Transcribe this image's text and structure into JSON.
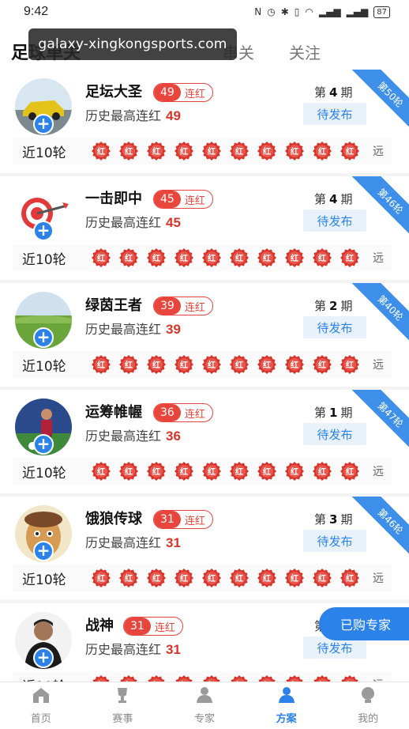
{
  "status": {
    "time": "9:42",
    "battery": "87",
    "icons": [
      "nfc",
      "alarm",
      "bluetooth",
      "vibrate",
      "wifi",
      "signal-1",
      "signal-2",
      "battery"
    ]
  },
  "watermark": "galaxy-xingkongsports.com",
  "top_tabs": [
    {
      "label": "足球单关",
      "active": true
    },
    {
      "label": "串关",
      "active": false
    },
    {
      "label": "关注",
      "active": false
    }
  ],
  "experts": [
    {
      "name": "足坛大圣",
      "streak": "49",
      "streak_label": "连红",
      "history_label": "历史最高连红",
      "history_value": "49",
      "issue_prefix": "第",
      "issue_num": "4",
      "issue_suffix": "期",
      "status": "待发布",
      "ribbon": "第50轮",
      "avatar": "car",
      "recent_label": "近10轮",
      "recent": [
        "红",
        "红",
        "红",
        "红",
        "红",
        "红",
        "红",
        "红",
        "红",
        "红"
      ],
      "more": "远"
    },
    {
      "name": "一击即中",
      "streak": "45",
      "streak_label": "连红",
      "history_label": "历史最高连红",
      "history_value": "45",
      "issue_prefix": "第",
      "issue_num": "4",
      "issue_suffix": "期",
      "status": "待发布",
      "ribbon": "第46轮",
      "avatar": "target",
      "recent_label": "近10轮",
      "recent": [
        "红",
        "红",
        "红",
        "红",
        "红",
        "红",
        "红",
        "红",
        "红",
        "红"
      ],
      "more": "远"
    },
    {
      "name": "绿茵王者",
      "streak": "39",
      "streak_label": "连红",
      "history_label": "历史最高连红",
      "history_value": "39",
      "issue_prefix": "第",
      "issue_num": "2",
      "issue_suffix": "期",
      "status": "待发布",
      "ribbon": "第40轮",
      "avatar": "landscape",
      "recent_label": "近10轮",
      "recent": [
        "红",
        "红",
        "红",
        "红",
        "红",
        "红",
        "红",
        "红",
        "红",
        "红"
      ],
      "more": "远"
    },
    {
      "name": "运筹帷幄",
      "streak": "36",
      "streak_label": "连红",
      "history_label": "历史最高连红",
      "history_value": "36",
      "issue_prefix": "第",
      "issue_num": "1",
      "issue_suffix": "期",
      "status": "待发布",
      "ribbon": "第47轮",
      "avatar": "player",
      "recent_label": "近10轮",
      "recent": [
        "红",
        "红",
        "红",
        "红",
        "红",
        "红",
        "红",
        "红",
        "红",
        "红"
      ],
      "more": "远"
    },
    {
      "name": "饿狼传球",
      "streak": "31",
      "streak_label": "连红",
      "history_label": "历史最高连红",
      "history_value": "31",
      "issue_prefix": "第",
      "issue_num": "3",
      "issue_suffix": "期",
      "status": "待发布",
      "ribbon": "第46轮",
      "avatar": "face",
      "recent_label": "近10轮",
      "recent": [
        "红",
        "红",
        "红",
        "红",
        "红",
        "红",
        "红",
        "红",
        "红",
        "红"
      ],
      "more": "远"
    },
    {
      "name": "战神",
      "streak": "31",
      "streak_label": "连红",
      "history_label": "历史最高连红",
      "history_value": "31",
      "issue_prefix": "第",
      "issue_num": "",
      "issue_suffix": "",
      "status": "待发布",
      "ribbon": "",
      "avatar": "man",
      "recent_label": "近10轮",
      "recent": [
        "红",
        "红",
        "红",
        "红",
        "红",
        "红",
        "红",
        "红",
        "红",
        "红"
      ],
      "more": "远"
    }
  ],
  "float_button": "已购专家",
  "bottom_nav": [
    {
      "label": "首页",
      "icon": "home-icon",
      "active": false
    },
    {
      "label": "赛事",
      "icon": "trophy-icon",
      "active": false
    },
    {
      "label": "专家",
      "icon": "expert-icon",
      "active": false
    },
    {
      "label": "方案",
      "icon": "plan-icon",
      "active": true
    },
    {
      "label": "我的",
      "icon": "profile-icon",
      "active": false
    }
  ],
  "colors": {
    "accent": "#2b82e8",
    "red": "#e8453c",
    "badge": "#d9342b"
  }
}
